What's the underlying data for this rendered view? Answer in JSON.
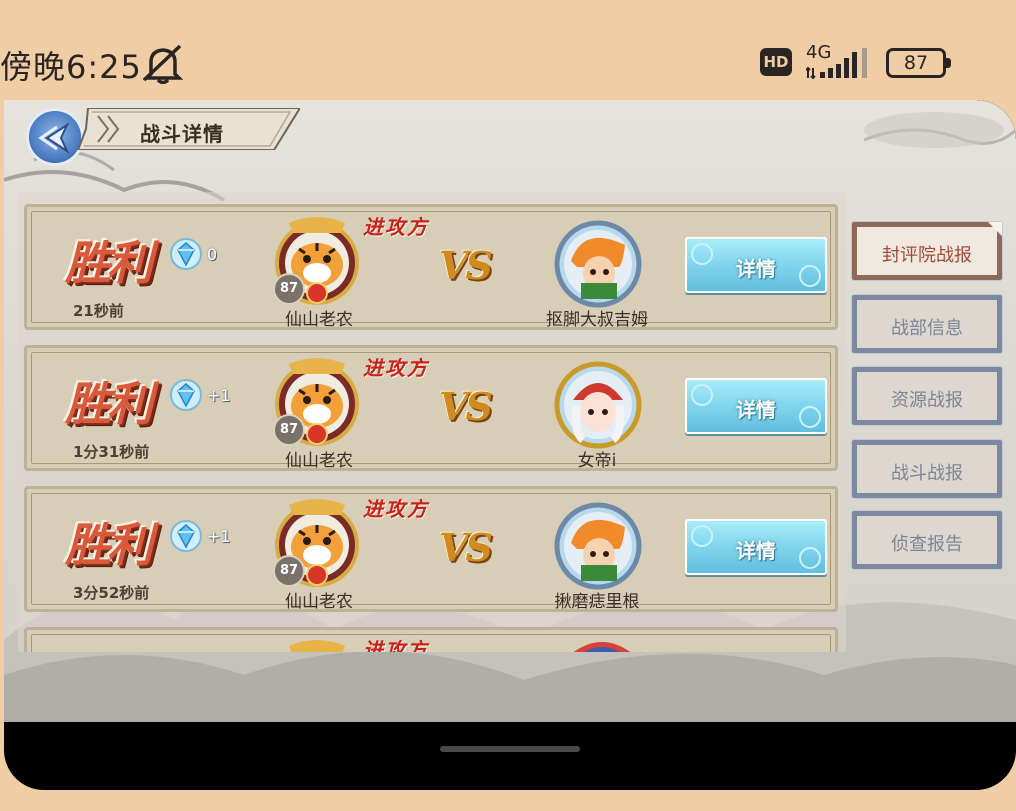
{
  "status_bar": {
    "time": "傍晚6:25",
    "hd_badge": "HD",
    "network": "4G",
    "battery": "87"
  },
  "header": {
    "title": "战斗详情"
  },
  "records": [
    {
      "result": "胜利",
      "gems": "0",
      "time_ago": "21秒前",
      "attacker_level": "87",
      "attacker_tag": "进攻方",
      "attacker_name": "仙山老农",
      "vs": "VS",
      "defender_name": "抠脚大叔吉姆",
      "detail_label": "详情"
    },
    {
      "result": "胜利",
      "gems": "+1",
      "time_ago": "1分31秒前",
      "attacker_level": "87",
      "attacker_tag": "进攻方",
      "attacker_name": "仙山老农",
      "vs": "VS",
      "defender_name": "女帝i",
      "detail_label": "详情"
    },
    {
      "result": "胜利",
      "gems": "+1",
      "time_ago": "3分52秒前",
      "attacker_level": "87",
      "attacker_tag": "进攻方",
      "attacker_name": "仙山老农",
      "vs": "VS",
      "defender_name": "揪磨痣里根",
      "detail_label": "详情"
    },
    {
      "attacker_tag": "进攻方"
    }
  ],
  "tabs": [
    {
      "label": "封评院战报",
      "active": true
    },
    {
      "label": "战部信息",
      "active": false
    },
    {
      "label": "资源战报",
      "active": false
    },
    {
      "label": "战斗战报",
      "active": false
    },
    {
      "label": "侦查报告",
      "active": false
    }
  ],
  "colors": {
    "status_bg": "#f1cda6",
    "win_red": "#d9593a",
    "detail_blue": "#7dd2ec",
    "tab_active": "#a14b36",
    "tab_inactive": "#7c8595"
  }
}
